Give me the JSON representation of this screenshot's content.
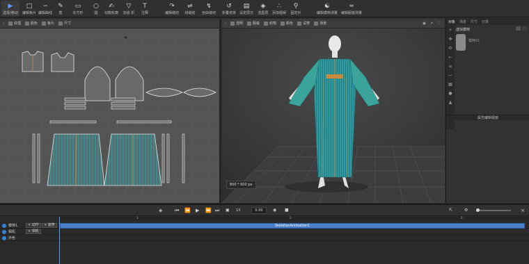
{
  "toolbar": {
    "items": [
      {
        "label": "选择/移动",
        "icon": "arrow-select-icon"
      },
      {
        "label": "编辑板片",
        "icon": "edit-pattern-icon"
      },
      {
        "label": "编辑曲线",
        "icon": "edit-curve-icon"
      },
      {
        "label": "笔",
        "icon": "pen-icon"
      },
      {
        "label": "长方形",
        "icon": "rectangle-icon"
      },
      {
        "label": "圆",
        "icon": "circle-icon"
      },
      {
        "label": "勾勒轮廓",
        "icon": "trace-icon"
      },
      {
        "label": "加省·折",
        "icon": "dart-icon"
      },
      {
        "label": "注释",
        "icon": "note-icon"
      },
      {
        "label": "编辑缝纫",
        "icon": "edit-sewing-icon"
      },
      {
        "label": "线缝纫",
        "icon": "segment-sewing-icon"
      },
      {
        "label": "自由缝纫",
        "icon": "free-sewing-icon"
      },
      {
        "label": "折叠安排",
        "icon": "fold-arrange-icon"
      },
      {
        "label": "设定层次",
        "icon": "layer-icon"
      },
      {
        "label": "选型层",
        "icon": "select-layer-icon"
      },
      {
        "label": "添加褶裥",
        "icon": "pleat-icon"
      },
      {
        "label": "固定针",
        "icon": "pin-icon"
      },
      {
        "label": "编辑模特测量",
        "icon": "avatar-measure-icon"
      },
      {
        "label": "编辑服装测量",
        "icon": "garment-measure-icon"
      }
    ]
  },
  "panel2d": {
    "tabs": [
      "",
      "纹理",
      "颜色",
      "板片",
      "尺寸"
    ]
  },
  "panel3d": {
    "tabs": [
      "透明",
      "服装",
      "织物",
      "颜色",
      "试穿",
      "场景"
    ],
    "resolution_label": "800 * 600 px"
  },
  "sidepanel": {
    "tabs": [
      "对象",
      "场景",
      "尺寸",
      "记录"
    ],
    "tree": [
      "虚拟模特",
      "模特01"
    ],
    "property_header": "属性编辑视窗"
  },
  "timeline": {
    "time_value": "0.00",
    "speed_label": "1X",
    "tracks": [
      {
        "name": "模特1",
        "buttons": [
          "+ 动作",
          "+ 姿势"
        ]
      },
      {
        "name": "相机",
        "buttons": [
          "+ 相机"
        ]
      },
      {
        "name": "外色",
        "buttons": []
      }
    ],
    "clip_label": "SkeletonAnimation1",
    "ruler_marks": [
      "1",
      "2",
      "3"
    ]
  },
  "colors": {
    "accent": "#2f86e0",
    "garment_teal": "#2f9aa0",
    "clip_blue": "#4a7fc9"
  }
}
